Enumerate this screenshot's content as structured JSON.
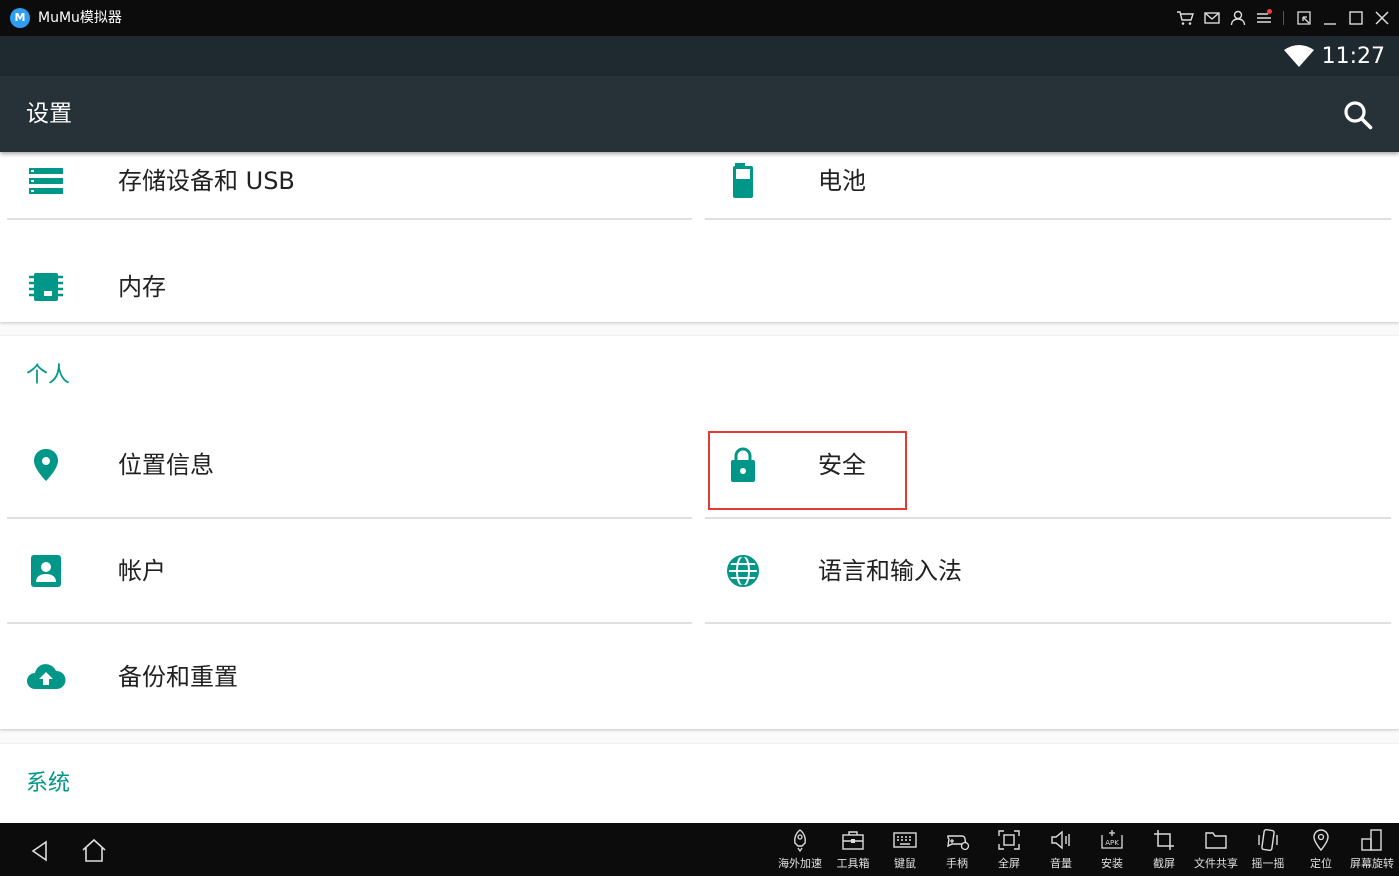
{
  "window": {
    "title": "MuMu模拟器",
    "logo_text": "M",
    "title_icons": [
      "cart-icon",
      "mail-icon",
      "user-icon",
      "menu-icon",
      "shrink-icon",
      "minimize-icon",
      "maximize-icon",
      "close-icon"
    ]
  },
  "status_bar": {
    "time": "11:27",
    "wifi": "full"
  },
  "toolbar": {
    "title": "设置",
    "search_icon": "search-icon"
  },
  "device_section": {
    "items": [
      {
        "label": "存储设备和 USB",
        "icon": "storage-icon"
      },
      {
        "label": "电池",
        "icon": "battery-icon"
      },
      {
        "label": "内存",
        "icon": "memory-icon"
      }
    ]
  },
  "personal_section": {
    "title": "个人",
    "items": [
      {
        "label": "位置信息",
        "icon": "location-icon"
      },
      {
        "label": "安全",
        "icon": "lock-icon"
      },
      {
        "label": "帐户",
        "icon": "account-icon"
      },
      {
        "label": "语言和输入法",
        "icon": "globe-icon"
      },
      {
        "label": "备份和重置",
        "icon": "cloud-upload-icon"
      }
    ]
  },
  "system_section": {
    "title": "系统"
  },
  "colors": {
    "accent": "#009688",
    "toolbar": "#263238",
    "status_bar": "#1f2a30",
    "highlight": "#e53935"
  },
  "bottom_tools": [
    {
      "label": "海外加速",
      "icon": "rocket-icon"
    },
    {
      "label": "工具箱",
      "icon": "toolbox-icon"
    },
    {
      "label": "键鼠",
      "icon": "keyboard-icon"
    },
    {
      "label": "手柄",
      "icon": "gamepad-icon"
    },
    {
      "label": "全屏",
      "icon": "fullscreen-icon"
    },
    {
      "label": "音量",
      "icon": "volume-icon"
    },
    {
      "label": "安装",
      "icon": "apk-icon"
    },
    {
      "label": "截屏",
      "icon": "crop-icon"
    },
    {
      "label": "文件共享",
      "icon": "folder-icon"
    },
    {
      "label": "摇一摇",
      "icon": "shake-icon"
    },
    {
      "label": "定位",
      "icon": "pin-icon"
    },
    {
      "label": "屏幕旋转",
      "icon": "rotate-icon"
    }
  ]
}
